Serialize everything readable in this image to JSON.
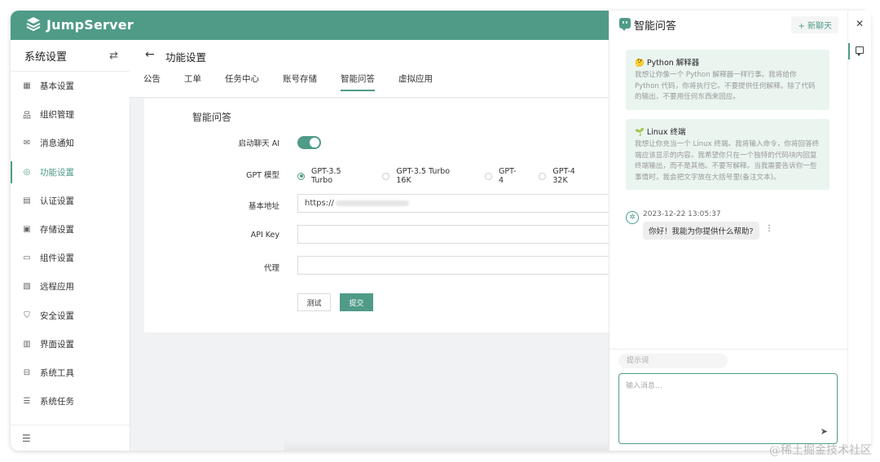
{
  "app": {
    "logo_text": "JumpServer",
    "accent_color": "#4f9b88"
  },
  "sidebar": {
    "title": "系统设置",
    "toggle_icon": "switch-arrows-icon",
    "items": [
      {
        "label": "基本设置",
        "icon": "grid-icon"
      },
      {
        "label": "组织管理",
        "icon": "org-icon"
      },
      {
        "label": "消息通知",
        "icon": "message-icon"
      },
      {
        "label": "功能设置",
        "icon": "feature-icon",
        "active": true
      },
      {
        "label": "认证设置",
        "icon": "id-card-icon"
      },
      {
        "label": "存储设置",
        "icon": "storage-icon"
      },
      {
        "label": "组件设置",
        "icon": "monitor-icon"
      },
      {
        "label": "远程应用",
        "icon": "remote-app-icon"
      },
      {
        "label": "安全设置",
        "icon": "shield-icon"
      },
      {
        "label": "界面设置",
        "icon": "interface-icon"
      },
      {
        "label": "系统工具",
        "icon": "toolbox-icon"
      },
      {
        "label": "系统任务",
        "icon": "task-list-icon"
      }
    ]
  },
  "header": {
    "title": "功能设置",
    "tabs": [
      {
        "label": "公告"
      },
      {
        "label": "工单"
      },
      {
        "label": "任务中心"
      },
      {
        "label": "账号存储"
      },
      {
        "label": "智能问答",
        "active": true
      },
      {
        "label": "虚拟应用"
      }
    ]
  },
  "form": {
    "section_title": "智能问答",
    "enable_label": "启动聊天 AI",
    "enable_value": true,
    "model_label": "GPT 模型",
    "models": [
      "GPT-3.5 Turbo",
      "GPT-3.5 Turbo 16K",
      "GPT-4",
      "GPT-4 32K"
    ],
    "selected_model": "GPT-3.5 Turbo",
    "base_url_label": "基本地址",
    "base_url_value": "https://",
    "api_key_label": "API Key",
    "api_key_value": "",
    "proxy_label": "代理",
    "proxy_value": "",
    "test_button": "测试",
    "submit_button": "提交"
  },
  "chat": {
    "title": "智能问答",
    "new_chat": "+ 新聊天",
    "prompts": [
      {
        "title": "🤔 Python 解释器",
        "body": "我想让你像一个 Python 解释器一样行事。我将给你 Python 代码，你将执行它。不要提供任何解释。除了代码的输出，不要用任何东西来回应。"
      },
      {
        "title": "🌱 Linux 终端",
        "body": "我想让你充当一个 Linux 终端。我将输入命令，你将回答终端应该显示的内容。我希望你只在一个独特的代码块内回复终端输出，而不是其他。不要写解释。当我需要告诉你一些事情时，我会把文字放在大括号里(备注文本)。"
      }
    ],
    "message": {
      "time": "2023-12-22 13:05:37",
      "text": "你好！我能为你提供什么帮助?"
    },
    "hint_placeholder": "提示词",
    "input_placeholder": "输入消息..."
  },
  "rail": {
    "close_icon": "close-icon",
    "chat_icon": "chat-icon"
  },
  "watermark": "@稀土掘金技术社区"
}
